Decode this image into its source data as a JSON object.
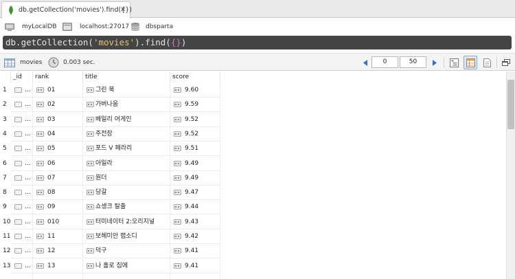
{
  "tab": {
    "title": "db.getCollection('movies').find({})",
    "close": "✕",
    "icon": "leaf-icon"
  },
  "connection": {
    "database": "myLocalDB",
    "host": "localhost:27017",
    "db": "dbsparta"
  },
  "query": {
    "prefix": "db.getCollection(",
    "collection_arg": "'movies'",
    "middle": ").find(",
    "arg": "{}",
    "suffix": ")"
  },
  "toolbar": {
    "collection": "movies",
    "exec_time": "0.003 sec.",
    "skip": "0",
    "limit": "50"
  },
  "columns": [
    "_id",
    "rank",
    "title",
    "score"
  ],
  "rows": [
    {
      "n": "1",
      "id": "...",
      "rank": "01",
      "title": "그린 북",
      "score": "9.60"
    },
    {
      "n": "2",
      "id": "...",
      "rank": "02",
      "title": "가버나움",
      "score": "9.59"
    },
    {
      "n": "3",
      "id": "...",
      "rank": "03",
      "title": "베일리 어게인",
      "score": "9.52"
    },
    {
      "n": "4",
      "id": "...",
      "rank": "04",
      "title": "주전장",
      "score": "9.52"
    },
    {
      "n": "5",
      "id": "...",
      "rank": "05",
      "title": "포드 V 페라리",
      "score": "9.51"
    },
    {
      "n": "6",
      "id": "...",
      "rank": "06",
      "title": "아일라",
      "score": "9.49"
    },
    {
      "n": "7",
      "id": "...",
      "rank": "07",
      "title": "원더",
      "score": "9.49"
    },
    {
      "n": "8",
      "id": "...",
      "rank": "08",
      "title": "당갈",
      "score": "9.47"
    },
    {
      "n": "9",
      "id": "...",
      "rank": "09",
      "title": "쇼생크 탈출",
      "score": "9.44"
    },
    {
      "n": "10",
      "id": "...",
      "rank": "010",
      "title": "터미네이터 2:오리지널",
      "score": "9.43"
    },
    {
      "n": "11",
      "id": "...",
      "rank": "11",
      "title": "보헤미안 랩소디",
      "score": "9.42"
    },
    {
      "n": "12",
      "id": "...",
      "rank": "12",
      "title": "덕구",
      "score": "9.41"
    },
    {
      "n": "13",
      "id": "...",
      "rank": "13",
      "title": "나 홀로 집에",
      "score": "9.41"
    }
  ]
}
